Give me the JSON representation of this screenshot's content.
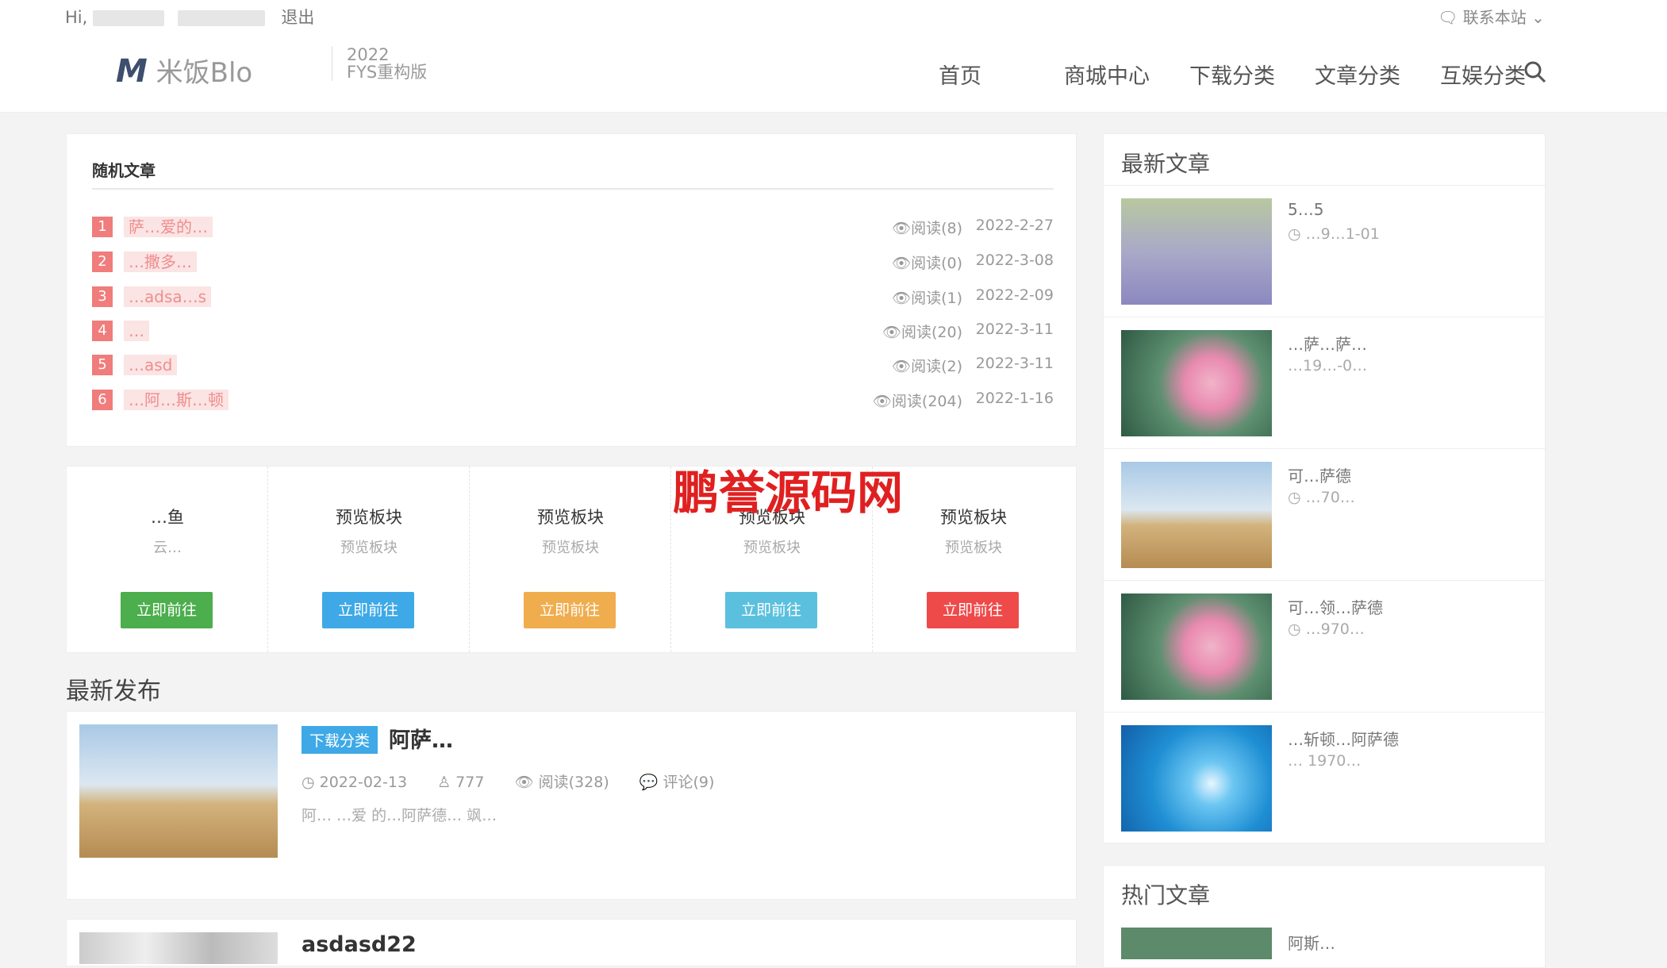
{
  "topbar": {
    "greeting": "Hi,",
    "logout": "退出",
    "contact": "联系本站 ⌄"
  },
  "header": {
    "logo_mark": "M",
    "logo_text": "米饭Blo",
    "version_year": "2022",
    "version_label": "FYS重构版",
    "nav": [
      "首页",
      "商城中心",
      "下载分类",
      "文章分类",
      "互娱分类"
    ]
  },
  "random": {
    "title": "随机文章",
    "items": [
      {
        "num": "1",
        "title": "萨…爱的…",
        "views": "👁阅读(8)",
        "date": "2022-2-27"
      },
      {
        "num": "2",
        "title": "…撒多…",
        "views": "👁阅读(0)",
        "date": "2022-3-08"
      },
      {
        "num": "3",
        "title": "…adsa…s",
        "views": "👁阅读(1)",
        "date": "2022-2-09"
      },
      {
        "num": "4",
        "title": "…",
        "views": "👁阅读(20)",
        "date": "2022-3-11"
      },
      {
        "num": "5",
        "title": "…asd",
        "views": "👁阅读(2)",
        "date": "2022-3-11"
      },
      {
        "num": "6",
        "title": "…阿…斯…顿",
        "views": "👁阅读(204)",
        "date": "2022-1-16"
      }
    ]
  },
  "blocks": [
    {
      "title": "…鱼",
      "sub": "云…",
      "btn": "立即前往",
      "color": "#4cae4c"
    },
    {
      "title": "预览板块",
      "sub": "预览板块",
      "btn": "立即前往",
      "color": "#3ea9e6"
    },
    {
      "title": "预览板块",
      "sub": "预览板块",
      "btn": "立即前往",
      "color": "#f0ad4e"
    },
    {
      "title": "预览板块",
      "sub": "预览板块",
      "btn": "立即前往",
      "color": "#5bc0de"
    },
    {
      "title": "预览板块",
      "sub": "预览板块",
      "btn": "立即前往",
      "color": "#ef4a4a"
    }
  ],
  "latest": {
    "title": "最新发布",
    "post": {
      "tag": "下载分类",
      "title": "阿萨…",
      "date": "◷ 2022-02-13",
      "author": "♙ 777",
      "views": "👁 阅读(328)",
      "comments": "💬 评论(9)",
      "excerpt": "阿… …爱 的…阿萨德… 飒…"
    },
    "post2_title": "asdasd22"
  },
  "sidebar": {
    "title": "最新文章",
    "items": [
      {
        "title": "5…5",
        "date": "◷ …9…1-01"
      },
      {
        "title": "…萨…萨…",
        "date": "…19…-0…"
      },
      {
        "title": "可…萨德",
        "date": "◷ …70…"
      },
      {
        "title": "可…领…萨德",
        "date": "◷ …970…"
      },
      {
        "title": "…斩顿…阿萨德",
        "date": "… 1970…"
      }
    ],
    "hot_title": "热门文章",
    "hot_item": "阿斯…"
  },
  "watermark": "鹏誉源码网"
}
